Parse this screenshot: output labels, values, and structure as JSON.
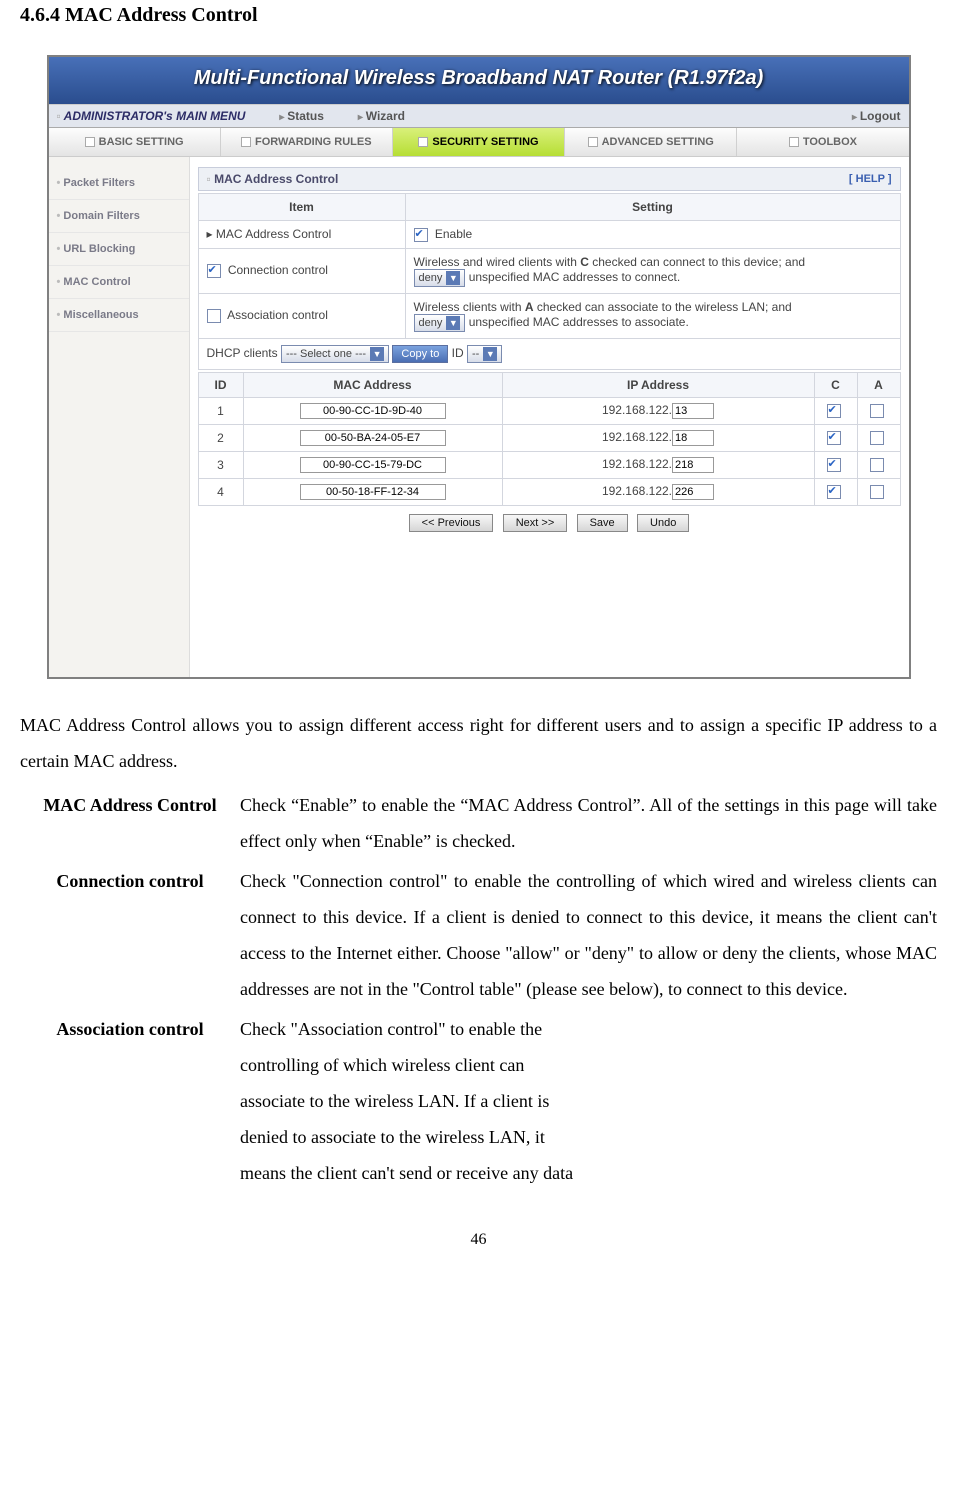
{
  "doc": {
    "section_heading": "4.6.4 MAC Address Control",
    "intro": "MAC Address Control allows you to assign different access right for different users and to assign a specific IP address to a certain MAC address.",
    "defs": {
      "mac_term": "MAC Address Control",
      "mac_body": "Check “Enable” to enable the “MAC Address Control”. All of the settings in this page will take effect only when “Enable” is checked.",
      "conn_term": "Connection control",
      "conn_body": "Check \"Connection control\" to enable the controlling of which wired and wireless clients can connect to this device. If a client is denied to connect to this device, it means the client can't access to the Internet either. Choose \"allow\" or \"deny\" to allow or deny the clients, whose MAC addresses are not in the \"Control table\" (please see below), to connect to this device.",
      "assoc_term": "Association control",
      "assoc_body_l1": "Check \"Association control\" to enable the",
      "assoc_body_l2": "controlling of which wireless client can",
      "assoc_body_l3": "associate to the wireless LAN. If a client is",
      "assoc_body_l4": "denied to associate to the wireless LAN, it",
      "assoc_body_l5": "means the client can't send or receive any data"
    },
    "page_number": "46"
  },
  "router": {
    "title": "Multi-Functional Wireless Broadband NAT Router (R1.97f2a)",
    "menubar": {
      "admin": "ADMINISTRATOR's MAIN MENU",
      "status": "Status",
      "wizard": "Wizard",
      "logout": "Logout"
    },
    "tabs": {
      "basic": "BASIC SETTING",
      "forwarding": "FORWARDING RULES",
      "security": "SECURITY SETTING",
      "advanced": "ADVANCED SETTING",
      "toolbox": "TOOLBOX"
    },
    "sidebar": {
      "packet_filters": "Packet Filters",
      "domain_filters": "Domain Filters",
      "url_blocking": "URL Blocking",
      "mac_control": "MAC Control",
      "miscellaneous": "Miscellaneous"
    },
    "panel": {
      "title": "MAC Address Control",
      "help": "[ HELP ]",
      "th_item": "Item",
      "th_setting": "Setting",
      "row_mac_label": "MAC Address Control",
      "row_mac_enable": "Enable",
      "row_conn_label": "Connection control",
      "row_conn_text_a": "Wireless and wired clients with ",
      "row_conn_text_b": " checked can connect to this device; and",
      "row_conn_sel": "deny",
      "row_conn_text_c": " unspecified MAC addresses to connect.",
      "row_conn_bold": "C",
      "row_assoc_label": "Association control",
      "row_assoc_text_a": "Wireless clients with ",
      "row_assoc_text_b": " checked can associate to the wireless LAN; and",
      "row_assoc_sel": "deny",
      "row_assoc_text_c": " unspecified MAC addresses to associate.",
      "row_assoc_bold": "A",
      "dhcp_label": "DHCP clients",
      "dhcp_sel": "--- Select one ---",
      "dhcp_copy": "Copy to",
      "dhcp_id_label": "ID",
      "dhcp_id_sel": "--"
    },
    "ctrl": {
      "th_id": "ID",
      "th_mac": "MAC Address",
      "th_ip": "IP Address",
      "th_c": "C",
      "th_a": "A",
      "ip_prefix": "192.168.122.",
      "rows": [
        {
          "id": "1",
          "mac": "00-90-CC-1D-9D-40",
          "ip": "13",
          "c": true,
          "a": false
        },
        {
          "id": "2",
          "mac": "00-50-BA-24-05-E7",
          "ip": "18",
          "c": true,
          "a": false
        },
        {
          "id": "3",
          "mac": "00-90-CC-15-79-DC",
          "ip": "218",
          "c": true,
          "a": false
        },
        {
          "id": "4",
          "mac": "00-50-18-FF-12-34",
          "ip": "226",
          "c": true,
          "a": false
        }
      ]
    },
    "buttons": {
      "prev": "<< Previous",
      "next": "Next >>",
      "save": "Save",
      "undo": "Undo"
    }
  }
}
